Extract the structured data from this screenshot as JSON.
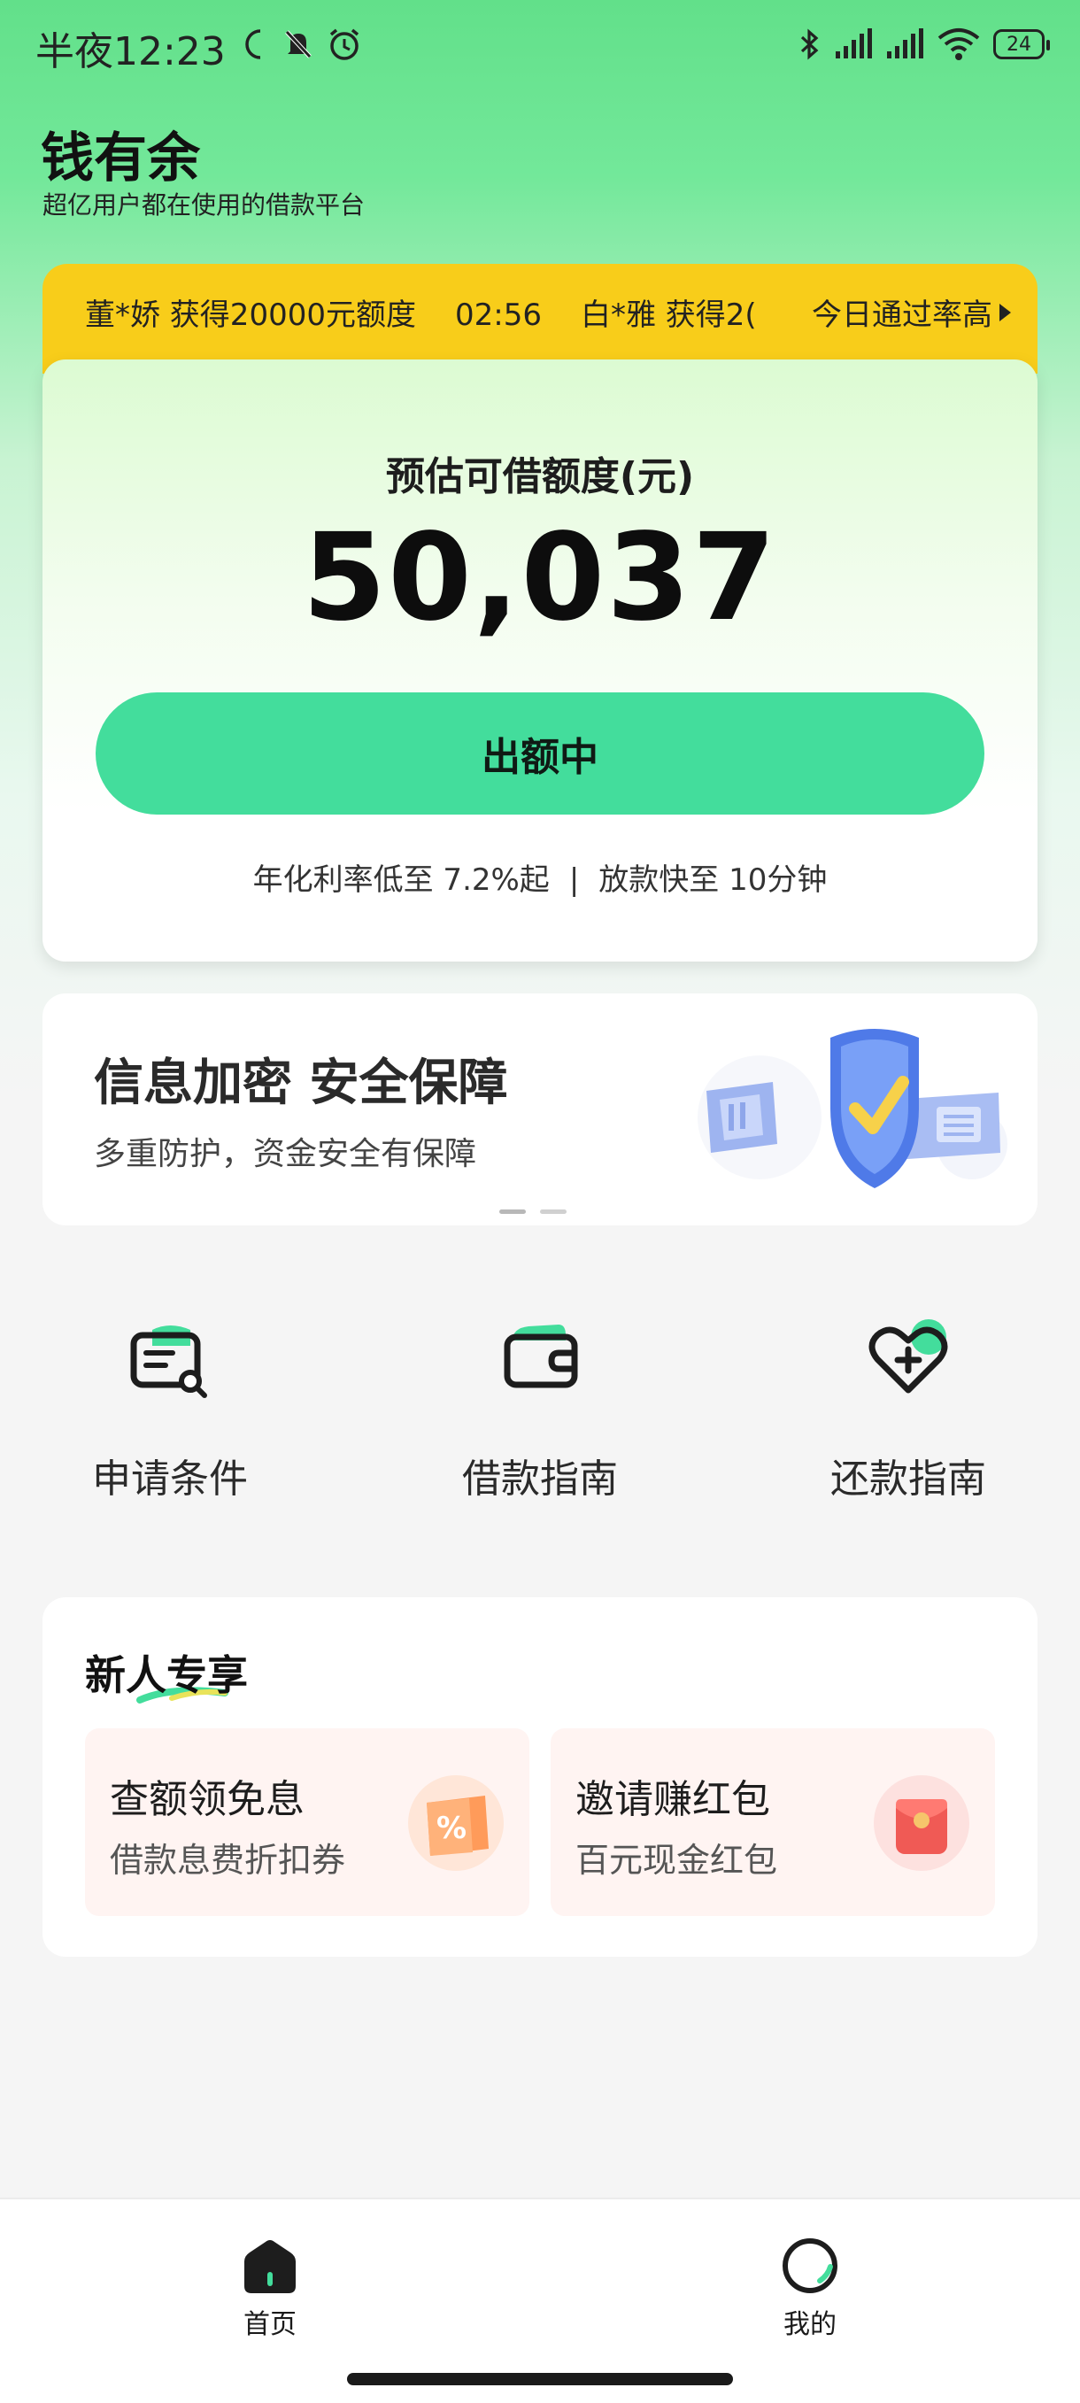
{
  "status_bar": {
    "time": "半夜12:23",
    "battery": "24",
    "icons": [
      "moon-icon",
      "mute-bell-icon",
      "alarm-icon",
      "bluetooth-icon",
      "signal-icon",
      "signal-icon",
      "wifi-icon",
      "battery-icon"
    ]
  },
  "header": {
    "title": "钱有余",
    "subtitle": "超亿用户都在使用的借款平台"
  },
  "ticker": {
    "items": [
      "董*娇 获得20000元额度",
      "02:56",
      "白*雅 获得2("
    ],
    "right_text": "今日通过率高"
  },
  "main_card": {
    "label": "预估可借额度(元)",
    "amount": "50,037",
    "button_label": "出额中",
    "note_left": "年化利率低至 7.2%起",
    "note_sep": "|",
    "note_right": "放款快至 10分钟"
  },
  "banner": {
    "title": "信息加密 安全保障",
    "subtitle": "多重防护，资金安全有保障",
    "page_count": 2,
    "active_page": 1
  },
  "quick_actions": [
    {
      "label": "申请条件",
      "icon": "application-conditions-icon"
    },
    {
      "label": "借款指南",
      "icon": "wallet-icon"
    },
    {
      "label": "还款指南",
      "icon": "heart-plus-icon"
    }
  ],
  "new_user": {
    "title": "新人专享",
    "cards": [
      {
        "title": "查额领免息",
        "subtitle": "借款息费折扣券",
        "icon": "discount-coupon-icon"
      },
      {
        "title": "邀请赚红包",
        "subtitle": "百元现金红包",
        "icon": "red-envelope-icon"
      }
    ]
  },
  "bottom_nav": {
    "items": [
      {
        "label": "首页",
        "icon": "home-icon",
        "active": true
      },
      {
        "label": "我的",
        "icon": "profile-icon",
        "active": false
      }
    ]
  },
  "colors": {
    "brand_green": "#43dd9c",
    "ticker_yellow": "#f8cd1a",
    "header_green": "#62e08a"
  }
}
